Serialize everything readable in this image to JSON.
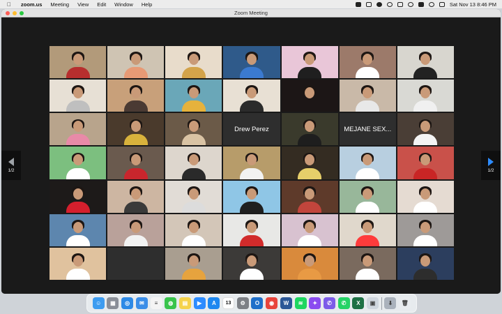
{
  "menubar": {
    "apple": "",
    "app_name": "zoom.us",
    "menus": [
      "Meeting",
      "View",
      "Edit",
      "Window",
      "Help"
    ],
    "clock": "Sat Nov 13  8:46 PM"
  },
  "window": {
    "title": "Zoom Meeting"
  },
  "gallery": {
    "page_left": "1/2",
    "page_right": "1/2",
    "tiles": [
      {
        "type": "video",
        "bg": "#b29a7a",
        "shirt": "#b72e2e",
        "sel": true
      },
      {
        "type": "video",
        "bg": "#cfc4b3",
        "shirt": "#e79a75"
      },
      {
        "type": "video",
        "bg": "#e8dccb",
        "shirt": "#d3a34a"
      },
      {
        "type": "video",
        "bg": "#2f5a8a",
        "shirt": "#3b7ad0"
      },
      {
        "type": "video",
        "bg": "#e9c6d8",
        "shirt": "#1f1f1f"
      },
      {
        "type": "video",
        "bg": "#9c7a6a",
        "shirt": "#ffffff"
      },
      {
        "type": "video",
        "bg": "#d8d6cf",
        "shirt": "#222222"
      },
      {
        "type": "video",
        "bg": "#e7e0d5",
        "shirt": "#bfbfbf"
      },
      {
        "type": "video",
        "bg": "#c8a07a",
        "shirt": "#4a3a33"
      },
      {
        "type": "video",
        "bg": "#6aa7b8",
        "shirt": "#e6b23c"
      },
      {
        "type": "video",
        "bg": "#e8e0d4",
        "shirt": "#2b2b2b"
      },
      {
        "type": "video",
        "bg": "#1c1616",
        "shirt": "#1c1616"
      },
      {
        "type": "video",
        "bg": "#c9b9a8",
        "shirt": "#e8e8e8"
      },
      {
        "type": "video",
        "bg": "#d9d9d4",
        "shirt": "#f0f0f0"
      },
      {
        "type": "video",
        "bg": "#b8a48c",
        "shirt": "#e88aa8"
      },
      {
        "type": "video",
        "bg": "#4a3a2c",
        "shirt": "#d8b23c"
      },
      {
        "type": "video",
        "bg": "#6b5a48",
        "shirt": "#d9c3a4"
      },
      {
        "type": "name",
        "label": "Drew Perez"
      },
      {
        "type": "video",
        "bg": "#3a3a2c",
        "shirt": "#1e1e1e"
      },
      {
        "type": "name",
        "label": "MEJANE SEX..."
      },
      {
        "type": "video",
        "bg": "#4a3e36",
        "shirt": "#f4f4f4"
      },
      {
        "type": "video",
        "bg": "#7cbf7f",
        "shirt": "#ffffff"
      },
      {
        "type": "video",
        "bg": "#6a5a4e",
        "shirt": "#c9262d"
      },
      {
        "type": "video",
        "bg": "#ddd6cd",
        "shirt": "#2a2a2a"
      },
      {
        "type": "video",
        "bg": "#b79c6a",
        "shirt": "#f2f2f2"
      },
      {
        "type": "video",
        "bg": "#342c22",
        "shirt": "#e6cf6a"
      },
      {
        "type": "video",
        "bg": "#b8cfe0",
        "shirt": "#ffffff"
      },
      {
        "type": "video",
        "bg": "#c9514a",
        "shirt": "#c92525"
      },
      {
        "type": "video",
        "bg": "#1d1a19",
        "shirt": "#d41f2d"
      },
      {
        "type": "video",
        "bg": "#cdb6a2",
        "shirt": "#3a3a3a"
      },
      {
        "type": "video",
        "bg": "#e1dcd6",
        "shirt": "#dcdcdc"
      },
      {
        "type": "video",
        "bg": "#8fc6e6",
        "shirt": "#1f1f1f"
      },
      {
        "type": "video",
        "bg": "#5e3a2a",
        "shirt": "#c2453c"
      },
      {
        "type": "video",
        "bg": "#98b79a",
        "shirt": "#ffffff"
      },
      {
        "type": "video",
        "bg": "#e5dbd2",
        "shirt": "#ffffff"
      },
      {
        "type": "video",
        "bg": "#5d86ae",
        "shirt": "#ffffff"
      },
      {
        "type": "video",
        "bg": "#b9a19a",
        "shirt": "#f2f2f2"
      },
      {
        "type": "video",
        "bg": "#d3c6b8",
        "shirt": "#ffffff"
      },
      {
        "type": "video",
        "bg": "#e8e8e6",
        "shirt": "#d12b2b"
      },
      {
        "type": "video",
        "bg": "#d8c2d0",
        "shirt": "#ffffff"
      },
      {
        "type": "video",
        "bg": "#e0d8cc",
        "shirt": "#ff3b3b"
      },
      {
        "type": "video",
        "bg": "#9e9a98",
        "shirt": "#ffffff"
      },
      {
        "type": "video",
        "bg": "#e0c29e",
        "shirt": "#ffffff"
      },
      {
        "type": "blank"
      },
      {
        "type": "video",
        "bg": "#a99e90",
        "shirt": "#e6a33e"
      },
      {
        "type": "video",
        "bg": "#3c3a38",
        "shirt": "#ffffff"
      },
      {
        "type": "video",
        "bg": "#d98a3c",
        "shirt": "#e89a44"
      },
      {
        "type": "video",
        "bg": "#7a6a5e",
        "shirt": "#ffffff"
      },
      {
        "type": "video",
        "bg": "#2c3e5e",
        "shirt": "#2d2d2d"
      }
    ]
  },
  "dock": {
    "items": [
      {
        "icon": "finder-icon",
        "color": "#3d9cf0",
        "glyph": "☺"
      },
      {
        "icon": "launchpad-icon",
        "color": "#8a8f98",
        "glyph": "▦"
      },
      {
        "icon": "safari-icon",
        "color": "#2e8ae6",
        "glyph": "◎"
      },
      {
        "icon": "mail-icon",
        "color": "#3b8ee8",
        "glyph": "✉"
      },
      {
        "icon": "reminders-icon",
        "color": "#f4f4f4",
        "glyph": "≡"
      },
      {
        "icon": "messages-icon",
        "color": "#39c44c",
        "glyph": "◍"
      },
      {
        "icon": "notes-icon",
        "color": "#f5d34c",
        "glyph": "▤"
      },
      {
        "icon": "zoom-icon",
        "color": "#2d8cff",
        "glyph": "▶"
      },
      {
        "icon": "app-store-icon",
        "color": "#1e88f0",
        "glyph": "A"
      },
      {
        "icon": "calendar-icon",
        "color": "#ffffff",
        "glyph": "13"
      },
      {
        "icon": "system-preferences-icon",
        "color": "#7d8085",
        "glyph": "⚙"
      },
      {
        "icon": "outlook-icon",
        "color": "#1f6fc9",
        "glyph": "O"
      },
      {
        "icon": "chrome-icon",
        "color": "#e8453c",
        "glyph": "◉"
      },
      {
        "icon": "word-icon",
        "color": "#2b5797",
        "glyph": "W"
      },
      {
        "icon": "spotify-icon",
        "color": "#1ed760",
        "glyph": "≋"
      },
      {
        "icon": "messenger-icon",
        "color": "#8a4cf0",
        "glyph": "✦"
      },
      {
        "icon": "viber-icon",
        "color": "#7c5ce8",
        "glyph": "✆"
      },
      {
        "icon": "whatsapp-icon",
        "color": "#25d366",
        "glyph": "✆"
      },
      {
        "icon": "excel-icon",
        "color": "#1e7145",
        "glyph": "X"
      },
      {
        "icon": "preview-icon",
        "color": "#cfd6de",
        "glyph": "▣"
      },
      {
        "icon": "downloads-icon",
        "color": "#aab2bc",
        "glyph": "⬇"
      },
      {
        "icon": "trash-icon",
        "color": "#e9ecef",
        "glyph": "🗑"
      }
    ]
  }
}
